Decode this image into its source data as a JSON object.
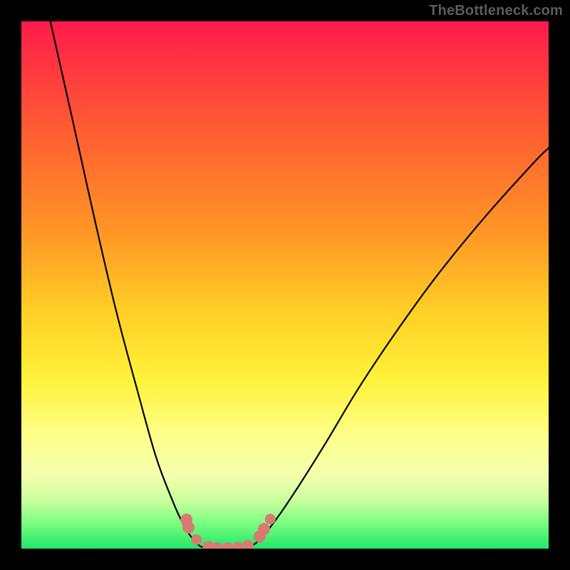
{
  "watermark": {
    "text": "TheBottleneck.com"
  },
  "colors": {
    "curve": "#000000",
    "marker_fill": "#d97a72",
    "marker_stroke": "#b85a52"
  },
  "chart_data": {
    "type": "line",
    "title": "",
    "xlabel": "",
    "ylabel": "",
    "xlim": [
      0,
      1
    ],
    "ylim": [
      0,
      1
    ],
    "series": [
      {
        "name": "left-branch",
        "x": [
          0.055,
          0.1,
          0.14,
          0.18,
          0.22,
          0.255,
          0.285,
          0.305,
          0.32,
          0.333,
          0.343
        ],
        "y": [
          1.0,
          0.8,
          0.62,
          0.45,
          0.3,
          0.175,
          0.095,
          0.05,
          0.025,
          0.01,
          0.003
        ]
      },
      {
        "name": "bottom-flat",
        "x": [
          0.343,
          0.36,
          0.38,
          0.4,
          0.418,
          0.432
        ],
        "y": [
          0.003,
          0.001,
          0.0,
          0.0,
          0.001,
          0.003
        ]
      },
      {
        "name": "right-branch",
        "x": [
          0.432,
          0.455,
          0.49,
          0.53,
          0.58,
          0.64,
          0.71,
          0.79,
          0.88,
          0.97,
          1.0
        ],
        "y": [
          0.003,
          0.02,
          0.065,
          0.125,
          0.205,
          0.305,
          0.41,
          0.52,
          0.63,
          0.73,
          0.76
        ]
      }
    ],
    "markers": [
      {
        "x": 0.313,
        "y": 0.055,
        "r": 8.5
      },
      {
        "x": 0.317,
        "y": 0.04,
        "r": 8.5
      },
      {
        "x": 0.332,
        "y": 0.017,
        "r": 7.5
      },
      {
        "x": 0.355,
        "y": 0.003,
        "r": 8.5
      },
      {
        "x": 0.372,
        "y": 0.001,
        "r": 8.2
      },
      {
        "x": 0.392,
        "y": 0.001,
        "r": 8.2
      },
      {
        "x": 0.412,
        "y": 0.002,
        "r": 8.2
      },
      {
        "x": 0.43,
        "y": 0.006,
        "r": 7.8
      },
      {
        "x": 0.452,
        "y": 0.023,
        "r": 8.5
      },
      {
        "x": 0.46,
        "y": 0.037,
        "r": 8.5
      },
      {
        "x": 0.472,
        "y": 0.056,
        "r": 7.5
      }
    ]
  }
}
